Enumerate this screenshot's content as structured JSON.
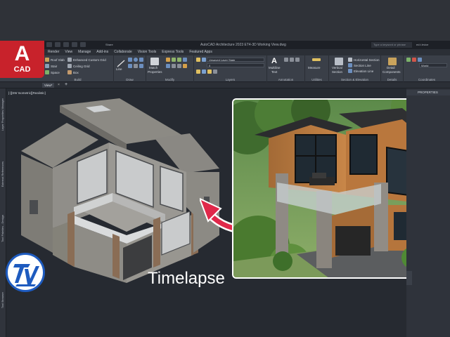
{
  "app": {
    "title": "AutoCAD Architecture 2023   ET4-3D Working View.dwg",
    "share_label": "Share",
    "search_placeholder": "Type a keyword or phrase",
    "user": "ed.t.trvice"
  },
  "logo": {
    "letter": "A",
    "product": "CAD"
  },
  "menu_tabs": [
    "Render",
    "View",
    "Manage",
    "Add-ins",
    "Collaborate",
    "Vision Tools",
    "Express Tools",
    "Featured Apps"
  ],
  "ribbon": {
    "build": {
      "title": "Build",
      "items": [
        "Roof Slab",
        "Stair",
        "Space",
        "Enhanced Custom Grid",
        "Ceiling Grid",
        "Box"
      ]
    },
    "draw": {
      "title": "Draw",
      "line": "Line"
    },
    "modify": {
      "title": "Modify",
      "match": "Match",
      "properties": "Properties"
    },
    "layers": {
      "title": "Layers",
      "layer_state": "Unsaved Layer State",
      "layer_value": "0"
    },
    "annotation": {
      "title": "Annotation",
      "text": "Multiline",
      "text2": "Text"
    },
    "utilities": {
      "title": "Utilities",
      "measure": "Measure"
    },
    "section": {
      "title": "Section & Elevation",
      "vertical": "Vertical",
      "section": "Section",
      "items": [
        "Horizontal Section",
        "Section Line",
        "Elevation Line"
      ]
    },
    "details": {
      "title": "Details",
      "label1": "Detail",
      "label2": "Components"
    },
    "coordinates": {
      "title": "Coordinates",
      "ucs": "World"
    }
  },
  "file_tab": {
    "label": "View*",
    "close": "×",
    "add": "+"
  },
  "viewport_label": "[-][SW Isometric][Realistic]",
  "left_palettes": [
    "Layer Properties Manager",
    "External References",
    "Tool Palettes - Design",
    "Tool Browser"
  ],
  "properties_label": "PROPERTIES",
  "caption": "Timelapse",
  "colors": {
    "accent_red": "#c8222b",
    "arrow_red": "#e0284a",
    "ribbon_bg": "#3a3f48"
  }
}
